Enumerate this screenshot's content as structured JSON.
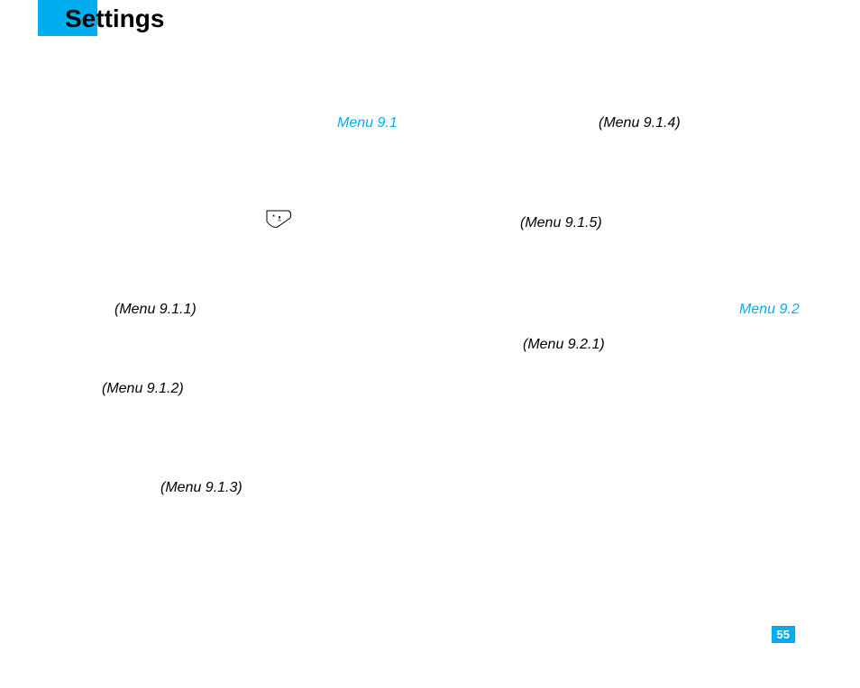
{
  "page": {
    "title": "Settings",
    "number": "55"
  },
  "menus": {
    "m91": "Menu 9.1",
    "m911": "(Menu 9.1.1)",
    "m912": "(Menu 9.1.2)",
    "m913": "(Menu 9.1.3)",
    "m914": "(Menu 9.1.4)",
    "m915": "(Menu 9.1.5)",
    "m92": "Menu 9.2",
    "m921": "(Menu 9.2.1)"
  }
}
